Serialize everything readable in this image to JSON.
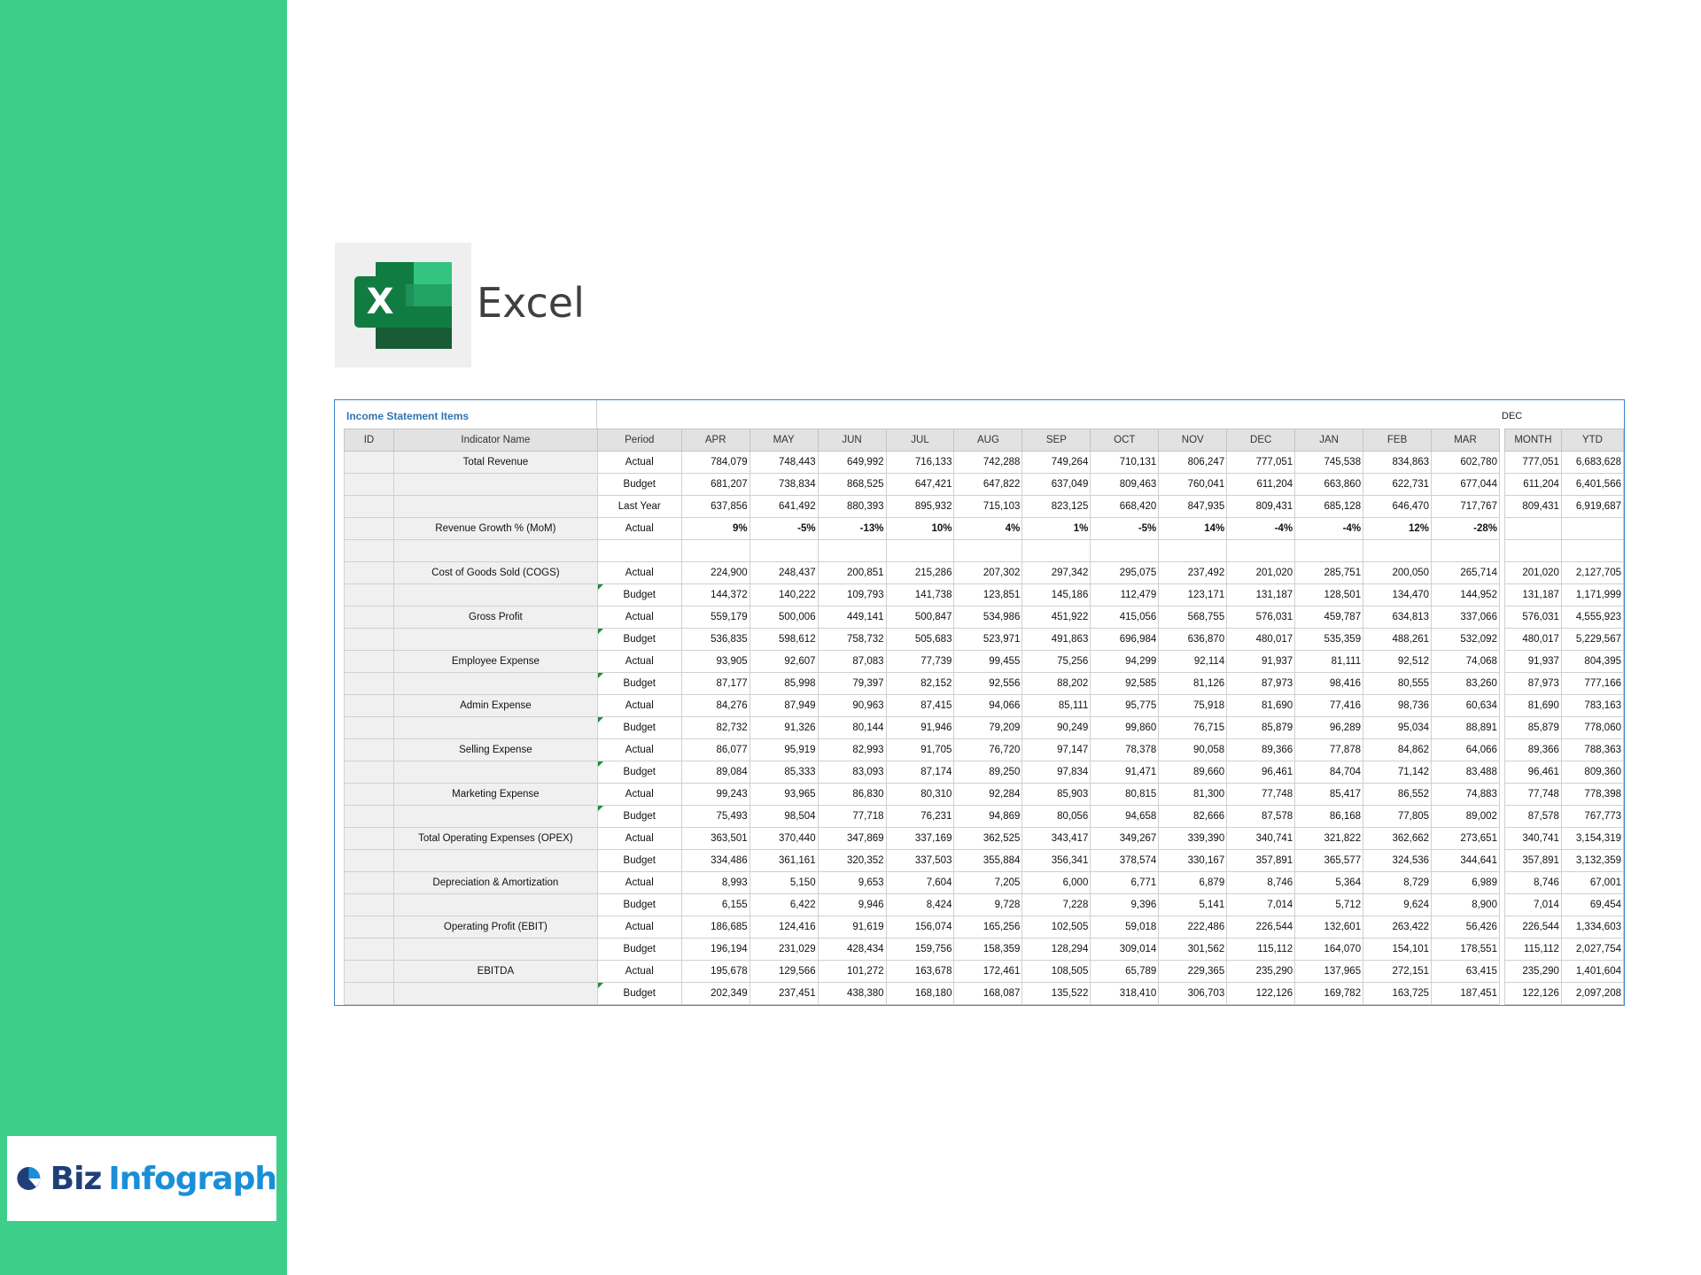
{
  "excel": {
    "title": "Excel"
  },
  "brand": {
    "biz": "Biz",
    "infograph": "Infograph"
  },
  "sheet": {
    "label": "Income Statement Items",
    "selected_month": "DEC",
    "headers": [
      "ID",
      "Indicator Name",
      "Period",
      "APR",
      "MAY",
      "JUN",
      "JUL",
      "AUG",
      "SEP",
      "OCT",
      "NOV",
      "DEC",
      "JAN",
      "FEB",
      "MAR"
    ],
    "summary_headers": [
      "MONTH",
      "YTD"
    ],
    "rows": [
      {
        "name": "Total Revenue",
        "period": "Actual",
        "values": [
          "784,079",
          "748,443",
          "649,992",
          "716,133",
          "742,288",
          "749,264",
          "710,131",
          "806,247",
          "777,051",
          "745,538",
          "834,863",
          "602,780"
        ],
        "summary": [
          "777,051",
          "6,683,628"
        ]
      },
      {
        "name": "",
        "period": "Budget",
        "values": [
          "681,207",
          "738,834",
          "868,525",
          "647,421",
          "647,822",
          "637,049",
          "809,463",
          "760,041",
          "611,204",
          "663,860",
          "622,731",
          "677,044"
        ],
        "summary": [
          "611,204",
          "6,401,566"
        ]
      },
      {
        "name": "",
        "period": "Last Year",
        "values": [
          "637,856",
          "641,492",
          "880,393",
          "895,932",
          "715,103",
          "823,125",
          "668,420",
          "847,935",
          "809,431",
          "685,128",
          "646,470",
          "717,767"
        ],
        "summary": [
          "809,431",
          "6,919,687"
        ]
      },
      {
        "name": "Revenue Growth % (MoM)",
        "period": "Actual",
        "bold": true,
        "values": [
          "9%",
          "-5%",
          "-13%",
          "10%",
          "4%",
          "1%",
          "-5%",
          "14%",
          "-4%",
          "-4%",
          "12%",
          "-28%"
        ],
        "summary": [
          "",
          ""
        ]
      },
      {
        "name": "",
        "period": "",
        "values": [
          "",
          "",
          "",
          "",
          "",
          "",
          "",
          "",
          "",
          "",
          "",
          ""
        ],
        "summary": [
          "",
          ""
        ]
      },
      {
        "name": "Cost of Goods Sold (COGS)",
        "period": "Actual",
        "values": [
          "224,900",
          "248,437",
          "200,851",
          "215,286",
          "207,302",
          "297,342",
          "295,075",
          "237,492",
          "201,020",
          "285,751",
          "200,050",
          "265,714"
        ],
        "summary": [
          "201,020",
          "2,127,705"
        ]
      },
      {
        "name": "",
        "period": "Budget",
        "flag": true,
        "values": [
          "144,372",
          "140,222",
          "109,793",
          "141,738",
          "123,851",
          "145,186",
          "112,479",
          "123,171",
          "131,187",
          "128,501",
          "134,470",
          "144,952"
        ],
        "summary": [
          "131,187",
          "1,171,999"
        ]
      },
      {
        "name": "Gross Profit",
        "period": "Actual",
        "values": [
          "559,179",
          "500,006",
          "449,141",
          "500,847",
          "534,986",
          "451,922",
          "415,056",
          "568,755",
          "576,031",
          "459,787",
          "634,813",
          "337,066"
        ],
        "summary": [
          "576,031",
          "4,555,923"
        ]
      },
      {
        "name": "",
        "period": "Budget",
        "flag": true,
        "values": [
          "536,835",
          "598,612",
          "758,732",
          "505,683",
          "523,971",
          "491,863",
          "696,984",
          "636,870",
          "480,017",
          "535,359",
          "488,261",
          "532,092"
        ],
        "summary": [
          "480,017",
          "5,229,567"
        ]
      },
      {
        "name": "Employee Expense",
        "period": "Actual",
        "values": [
          "93,905",
          "92,607",
          "87,083",
          "77,739",
          "99,455",
          "75,256",
          "94,299",
          "92,114",
          "91,937",
          "81,111",
          "92,512",
          "74,068"
        ],
        "summary": [
          "91,937",
          "804,395"
        ]
      },
      {
        "name": "",
        "period": "Budget",
        "flag": true,
        "values": [
          "87,177",
          "85,998",
          "79,397",
          "82,152",
          "92,556",
          "88,202",
          "92,585",
          "81,126",
          "87,973",
          "98,416",
          "80,555",
          "83,260"
        ],
        "summary": [
          "87,973",
          "777,166"
        ]
      },
      {
        "name": "Admin Expense",
        "period": "Actual",
        "values": [
          "84,276",
          "87,949",
          "90,963",
          "87,415",
          "94,066",
          "85,111",
          "95,775",
          "75,918",
          "81,690",
          "77,416",
          "98,736",
          "60,634"
        ],
        "summary": [
          "81,690",
          "783,163"
        ]
      },
      {
        "name": "",
        "period": "Budget",
        "flag": true,
        "values": [
          "82,732",
          "91,326",
          "80,144",
          "91,946",
          "79,209",
          "90,249",
          "99,860",
          "76,715",
          "85,879",
          "96,289",
          "95,034",
          "88,891"
        ],
        "summary": [
          "85,879",
          "778,060"
        ]
      },
      {
        "name": "Selling Expense",
        "period": "Actual",
        "values": [
          "86,077",
          "95,919",
          "82,993",
          "91,705",
          "76,720",
          "97,147",
          "78,378",
          "90,058",
          "89,366",
          "77,878",
          "84,862",
          "64,066"
        ],
        "summary": [
          "89,366",
          "788,363"
        ]
      },
      {
        "name": "",
        "period": "Budget",
        "flag": true,
        "values": [
          "89,084",
          "85,333",
          "83,093",
          "87,174",
          "89,250",
          "97,834",
          "91,471",
          "89,660",
          "96,461",
          "84,704",
          "71,142",
          "83,488"
        ],
        "summary": [
          "96,461",
          "809,360"
        ]
      },
      {
        "name": "Marketing Expense",
        "period": "Actual",
        "values": [
          "99,243",
          "93,965",
          "86,830",
          "80,310",
          "92,284",
          "85,903",
          "80,815",
          "81,300",
          "77,748",
          "85,417",
          "86,552",
          "74,883"
        ],
        "summary": [
          "77,748",
          "778,398"
        ]
      },
      {
        "name": "",
        "period": "Budget",
        "flag": true,
        "values": [
          "75,493",
          "98,504",
          "77,718",
          "76,231",
          "94,869",
          "80,056",
          "94,658",
          "82,666",
          "87,578",
          "86,168",
          "77,805",
          "89,002"
        ],
        "summary": [
          "87,578",
          "767,773"
        ]
      },
      {
        "name": "Total Operating Expenses (OPEX)",
        "period": "Actual",
        "values": [
          "363,501",
          "370,440",
          "347,869",
          "337,169",
          "362,525",
          "343,417",
          "349,267",
          "339,390",
          "340,741",
          "321,822",
          "362,662",
          "273,651"
        ],
        "summary": [
          "340,741",
          "3,154,319"
        ]
      },
      {
        "name": "",
        "period": "Budget",
        "values": [
          "334,486",
          "361,161",
          "320,352",
          "337,503",
          "355,884",
          "356,341",
          "378,574",
          "330,167",
          "357,891",
          "365,577",
          "324,536",
          "344,641"
        ],
        "summary": [
          "357,891",
          "3,132,359"
        ]
      },
      {
        "name": "Depreciation & Amortization",
        "period": "Actual",
        "values": [
          "8,993",
          "5,150",
          "9,653",
          "7,604",
          "7,205",
          "6,000",
          "6,771",
          "6,879",
          "8,746",
          "5,364",
          "8,729",
          "6,989"
        ],
        "summary": [
          "8,746",
          "67,001"
        ]
      },
      {
        "name": "",
        "period": "Budget",
        "values": [
          "6,155",
          "6,422",
          "9,946",
          "8,424",
          "9,728",
          "7,228",
          "9,396",
          "5,141",
          "7,014",
          "5,712",
          "9,624",
          "8,900"
        ],
        "summary": [
          "7,014",
          "69,454"
        ]
      },
      {
        "name": "Operating Profit (EBIT)",
        "period": "Actual",
        "values": [
          "186,685",
          "124,416",
          "91,619",
          "156,074",
          "165,256",
          "102,505",
          "59,018",
          "222,486",
          "226,544",
          "132,601",
          "263,422",
          "56,426"
        ],
        "summary": [
          "226,544",
          "1,334,603"
        ]
      },
      {
        "name": "",
        "period": "Budget",
        "values": [
          "196,194",
          "231,029",
          "428,434",
          "159,756",
          "158,359",
          "128,294",
          "309,014",
          "301,562",
          "115,112",
          "164,070",
          "154,101",
          "178,551"
        ],
        "summary": [
          "115,112",
          "2,027,754"
        ]
      },
      {
        "name": "EBITDA",
        "period": "Actual",
        "values": [
          "195,678",
          "129,566",
          "101,272",
          "163,678",
          "172,461",
          "108,505",
          "65,789",
          "229,365",
          "235,290",
          "137,965",
          "272,151",
          "63,415"
        ],
        "summary": [
          "235,290",
          "1,401,604"
        ]
      },
      {
        "name": "",
        "period": "Budget",
        "flag": true,
        "values": [
          "202,349",
          "237,451",
          "438,380",
          "168,180",
          "168,087",
          "135,522",
          "318,410",
          "306,703",
          "122,126",
          "169,782",
          "163,725",
          "187,451"
        ],
        "summary": [
          "122,126",
          "2,097,208"
        ]
      }
    ]
  }
}
